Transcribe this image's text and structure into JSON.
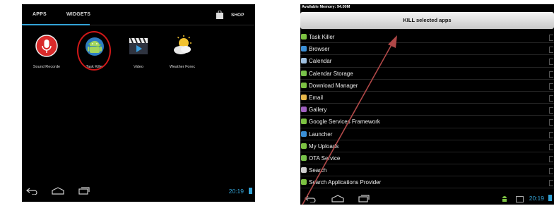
{
  "left_screen": {
    "tabs": [
      {
        "label": "APPS",
        "active": true
      },
      {
        "label": "WIDGETS",
        "active": false
      }
    ],
    "shop_label": "SHOP",
    "apps": [
      {
        "label": "Sound Recorde",
        "icon": "microphone-icon"
      },
      {
        "label": "Task Killer",
        "icon": "android-globe-icon",
        "highlighted": true
      },
      {
        "label": "Video",
        "icon": "clapperboard-icon"
      },
      {
        "label": "Weather Forec",
        "icon": "weather-icon"
      }
    ],
    "clock": "20:19"
  },
  "right_screen": {
    "memory": "Available Memory: 94.00M",
    "kill_button": "KILL selected apps",
    "apps": [
      {
        "label": "Task Killer",
        "icon_color": "#7cc242"
      },
      {
        "label": "Browser",
        "icon_color": "#3a8fd6"
      },
      {
        "label": "Calendar",
        "icon_color": "#9fc0e0"
      },
      {
        "label": "Calendar Storage",
        "icon_color": "#78c24a"
      },
      {
        "label": "Download Manager",
        "icon_color": "#7cc242"
      },
      {
        "label": "Email",
        "icon_color": "#e8b84a"
      },
      {
        "label": "Gallery",
        "icon_color": "#a060c0"
      },
      {
        "label": "Google Services Framework",
        "icon_color": "#7cc242"
      },
      {
        "label": "Launcher",
        "icon_color": "#3a8fd6"
      },
      {
        "label": "My Uploads",
        "icon_color": "#7cc242"
      },
      {
        "label": "OTA Service",
        "icon_color": "#78c24a"
      },
      {
        "label": "Search",
        "icon_color": "#cfcfcf"
      },
      {
        "label": "Search Applications Provider",
        "icon_color": "#7cc242"
      }
    ],
    "clock": "20:19"
  },
  "colors": {
    "accent": "#33a3d6",
    "highlight": "#d01818",
    "arrow": "#b04848"
  }
}
